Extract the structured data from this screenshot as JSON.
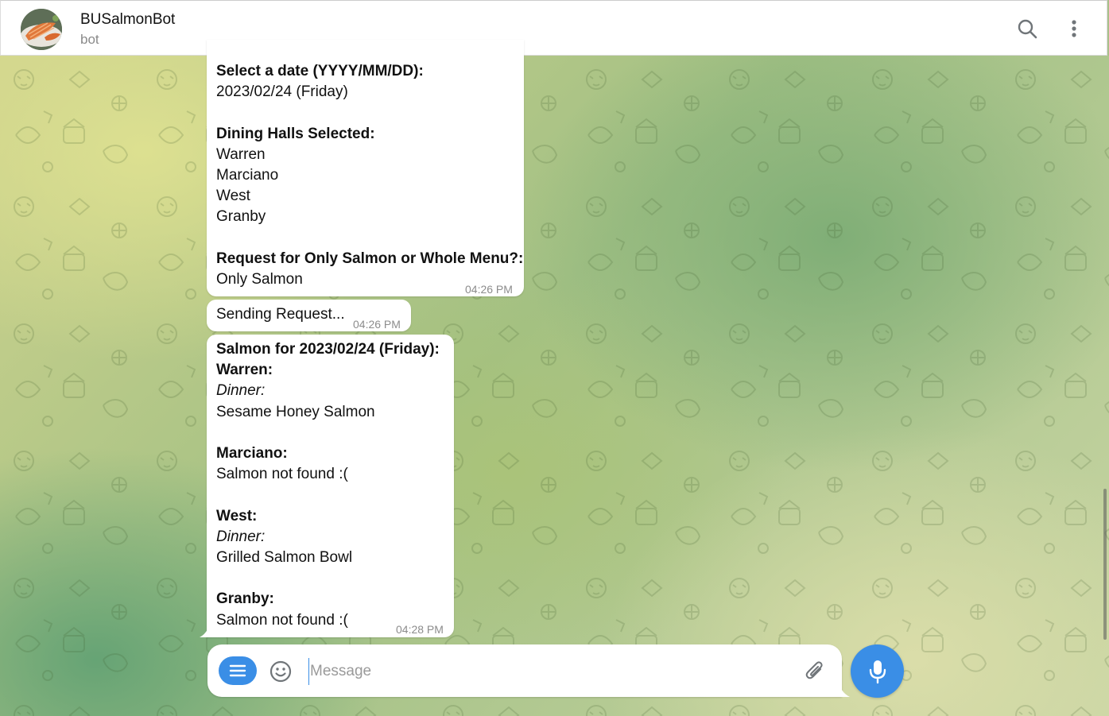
{
  "colors": {
    "accent": "#3a8ee6",
    "bubble": "#ffffff",
    "time": "#8c8c8c"
  },
  "header": {
    "title": "BUSalmonBot",
    "subtitle": "bot",
    "avatar_icon": "salmon-photo",
    "search_icon": "search-icon",
    "more_icon": "more-vertical-icon"
  },
  "messages": [
    {
      "lines": [
        {
          "t": "Select a date (YYYY/MM/DD):",
          "s": "bold"
        },
        {
          "t": "2023/02/24 (Friday)",
          "s": "normal"
        },
        {
          "t": "",
          "s": "gap"
        },
        {
          "t": "Dining Halls Selected:",
          "s": "bold"
        },
        {
          "t": "Warren",
          "s": "normal"
        },
        {
          "t": "Marciano",
          "s": "normal"
        },
        {
          "t": "West",
          "s": "normal"
        },
        {
          "t": "Granby",
          "s": "normal"
        },
        {
          "t": "",
          "s": "gap"
        },
        {
          "t": "Request for Only Salmon or Whole Menu?:",
          "s": "bold"
        },
        {
          "t": "Only Salmon",
          "s": "normal"
        }
      ],
      "time": "04:26 PM"
    },
    {
      "text": "Sending Request...",
      "time": "04:26 PM"
    },
    {
      "lines": [
        {
          "t": "Salmon for 2023/02/24 (Friday):",
          "s": "bold"
        },
        {
          "t": "Warren:",
          "s": "bold"
        },
        {
          "t": "Dinner:",
          "s": "italic"
        },
        {
          "t": "Sesame Honey Salmon",
          "s": "normal"
        },
        {
          "t": "",
          "s": "gap"
        },
        {
          "t": "Marciano:",
          "s": "bold"
        },
        {
          "t": "Salmon not found :(",
          "s": "normal"
        },
        {
          "t": "",
          "s": "gap"
        },
        {
          "t": "West:",
          "s": "bold"
        },
        {
          "t": "Dinner:",
          "s": "italic"
        },
        {
          "t": "Grilled Salmon Bowl",
          "s": "normal"
        },
        {
          "t": "",
          "s": "gap"
        },
        {
          "t": "Granby:",
          "s": "bold"
        },
        {
          "t": "Salmon not found :(",
          "s": "normal"
        }
      ],
      "time": "04:28 PM"
    }
  ],
  "composer": {
    "placeholder": "Message",
    "value": "",
    "menu_icon": "menu-icon",
    "emoji_icon": "smiley-icon",
    "attach_icon": "paperclip-icon",
    "mic_icon": "microphone-icon"
  }
}
